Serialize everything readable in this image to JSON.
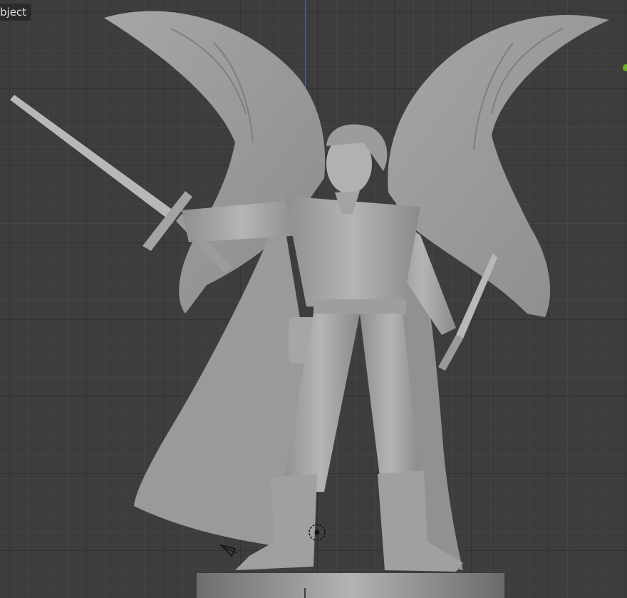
{
  "header": {
    "mode_label": "bject"
  },
  "colors": {
    "viewport_bg": "#3d3d3d",
    "grid_minor": "#454545",
    "grid_major": "#333333",
    "y_axis": "#4a6fb0",
    "model_gray": "#a8a8a8",
    "origin_dot": "#6fae2a"
  },
  "icons": {
    "camera": "camera-gizmo-icon",
    "light": "light-gizmo-icon",
    "origin": "object-origin-icon"
  }
}
